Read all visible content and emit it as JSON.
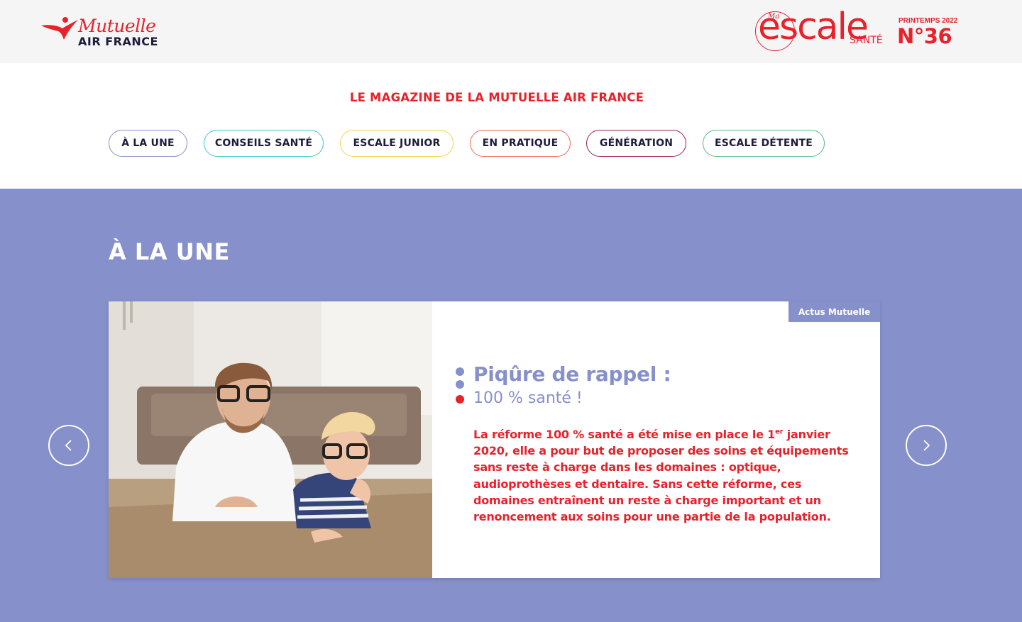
{
  "header": {
    "brand": {
      "line1": "Mutuelle",
      "line2": "AIR FRANCE"
    },
    "magazine": {
      "ma": "Ma",
      "word": "escale",
      "sante": "SANTÉ",
      "season": "PRINTEMPS 2022",
      "number": "N°36"
    }
  },
  "tagline": "LE MAGAZINE DE LA MUTUELLE AIR FRANCE",
  "nav": {
    "items": [
      {
        "label": "À LA UNE",
        "color": "#8690cb"
      },
      {
        "label": "CONSEILS SANTÉ",
        "color": "#3fc6cf"
      },
      {
        "label": "ESCALE JUNIOR",
        "color": "#f4d24a"
      },
      {
        "label": "EN PRATIQUE",
        "color": "#ef6a5a"
      },
      {
        "label": "GÉNÉRATION",
        "color": "#9e1d4d"
      },
      {
        "label": "ESCALE DÉTENTE",
        "color": "#5ab98a"
      }
    ]
  },
  "feature": {
    "section_title": "À LA UNE",
    "card": {
      "badge": "Actus Mutuelle",
      "headline": "Piqûre de rappel :",
      "subhead": "100 % santé !",
      "body_before_sup": "La réforme 100 % santé a été mise en place le 1",
      "body_sup": "er",
      "body_after_sup": " janvier 2020, elle a pour but de proposer des soins et équipements sans reste à charge dans les domaines : optique, audioprothèses et dentaire. Sans cette réforme, ces domaines entraînent un reste à charge important et un renoncement aux soins pour une partie de la population."
    }
  },
  "colors": {
    "brand_red": "#e8212b",
    "accent_periwinkle": "#8690cb",
    "navy": "#1d1d3b"
  },
  "icons": {
    "prev": "chevron-left-icon",
    "next": "chevron-right-icon",
    "brand": "air-france-swallow-logo"
  }
}
